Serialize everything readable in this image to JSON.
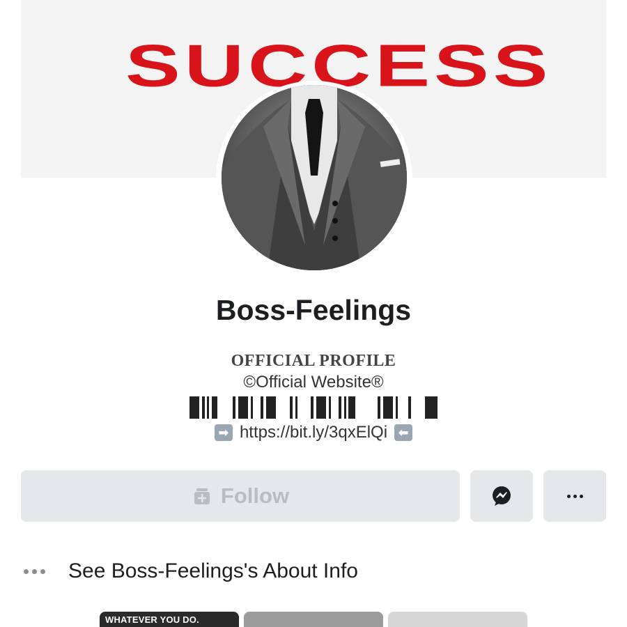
{
  "cover": {
    "text": "SUCCESS",
    "text_color": "#d8141a"
  },
  "profile": {
    "name": "Boss-Feelings",
    "avatar_icon": "man-in-suit-photo"
  },
  "bio": {
    "title": "OFFICIAL PROFILE",
    "line": "©Official Website®",
    "barcode_icon": "barcode-icon",
    "link": "https://bit.ly/3qxElQi",
    "left_arrow_icon": "right-arrow-emoji-icon",
    "right_arrow_icon": "left-arrow-emoji-icon"
  },
  "actions": {
    "follow_label": "Follow",
    "follow_icon": "follow-plus-icon",
    "messenger_icon": "messenger-icon",
    "more_icon": "more-icon"
  },
  "about": {
    "label": "See Boss-Feelings's About Info"
  },
  "thumbnails": [
    {
      "caption": "WHATEVER YOU DO."
    },
    {
      "caption": ""
    },
    {
      "caption": ""
    }
  ],
  "colors": {
    "button_bg": "#e6e7ea",
    "disabled_text": "#b9bcc1",
    "accent_red": "#d8141a"
  }
}
